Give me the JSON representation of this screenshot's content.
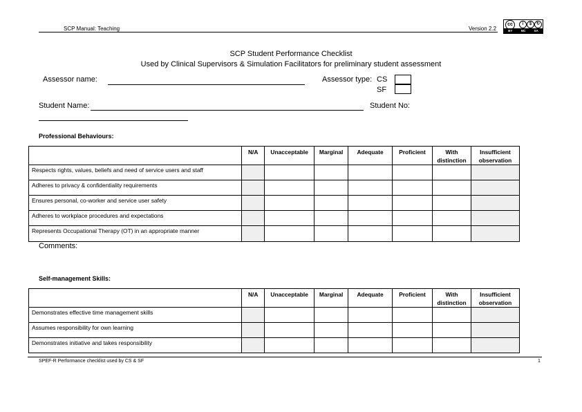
{
  "header": {
    "manual": "SCP Manual: Teaching",
    "version": "Version 2.2",
    "license_badges": [
      "BY",
      "NC",
      "SA"
    ]
  },
  "title": {
    "line1": "SCP Student Performance Checklist",
    "line2": "Used by Clinical Supervisors & Simulation Facilitators for preliminary student assessment"
  },
  "form": {
    "assessor_name_label": "Assessor name:",
    "assessor_type_label": "Assessor type:",
    "type_cs": "CS",
    "type_sf": "SF",
    "student_name_label": "Student Name:",
    "student_no_label": "Student No:"
  },
  "columns": [
    "N/A",
    "Unacceptable",
    "Marginal",
    "Adequate",
    "Proficient",
    "With distinction",
    "Insufficient observation"
  ],
  "professional": {
    "heading": "Professional Behaviours:",
    "items": [
      "Respects rights, values, beliefs and need of service users and staff",
      "Adheres to privacy & confidentiality requirements",
      "Ensures personal, co-worker and service user safety",
      "Adheres to workplace procedures and expectations",
      "Represents Occupational Therapy (OT) in an appropriate manner"
    ],
    "comments_label": "Comments:"
  },
  "selfmgmt": {
    "heading": "Self-management Skills:",
    "items": [
      "Demonstrates effective time management skills",
      "Assumes responsibility for own learning",
      "Demonstrates initiative and takes responsibility"
    ]
  },
  "footer": {
    "left": "SPEF-R Performance checklist used by CS & SF",
    "page": "1"
  }
}
